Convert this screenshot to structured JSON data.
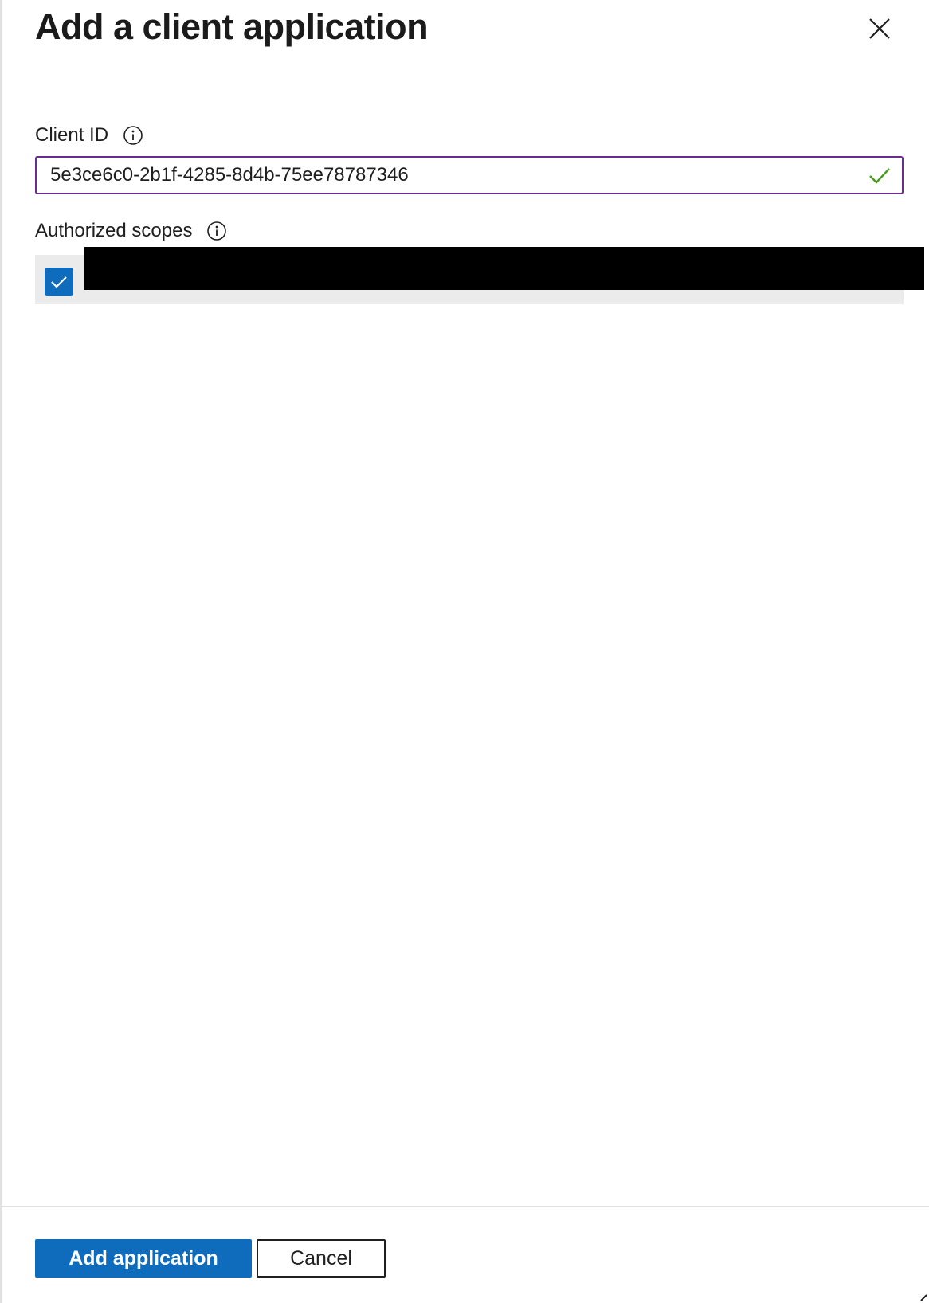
{
  "dialog": {
    "title": "Add a client application"
  },
  "client_id": {
    "label": "Client ID",
    "value": "5e3ce6c0-2b1f-4285-8d4b-75ee78787346",
    "valid": true
  },
  "authorized_scopes": {
    "label": "Authorized scopes",
    "items": [
      {
        "label": "",
        "checked": true,
        "redacted": true
      }
    ]
  },
  "footer": {
    "primary_label": "Add application",
    "secondary_label": "Cancel"
  },
  "colors": {
    "accent": "#0f6cbd",
    "input_focus_border": "#6b2c91",
    "valid_check": "#4a9a1e",
    "scope_row_bg": "#ebebeb"
  },
  "icons": {
    "close": "close-icon",
    "info": "info-icon",
    "valid": "checkmark-icon",
    "checkbox": "checkbox-checked-icon"
  }
}
